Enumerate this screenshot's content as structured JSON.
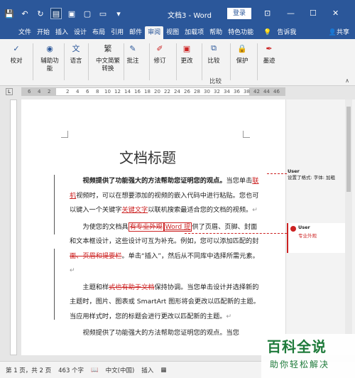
{
  "window": {
    "title": "文档3 - Word",
    "login_label": "登录",
    "controls": [
      "⊡",
      "—",
      "☐",
      "✕"
    ]
  },
  "quick_access": [
    "save",
    "undo",
    "redo",
    "read-mode",
    "page-setup",
    "new-doc",
    "open-doc",
    "more"
  ],
  "tabs": [
    {
      "label": "文件"
    },
    {
      "label": "开始"
    },
    {
      "label": "插入"
    },
    {
      "label": "设计"
    },
    {
      "label": "布局"
    },
    {
      "label": "引用"
    },
    {
      "label": "邮件"
    },
    {
      "label": "审阅",
      "active": true
    },
    {
      "label": "视图"
    },
    {
      "label": "加载项"
    },
    {
      "label": "帮助"
    },
    {
      "label": "特色功能"
    },
    {
      "label": "告诉我"
    },
    {
      "label": "共享"
    }
  ],
  "ribbon": {
    "groups": [
      {
        "label": "校对",
        "icon": "spellcheck-icon"
      },
      {
        "label": "辅助功能",
        "icon": "accessibility-icon"
      },
      {
        "label": "语言",
        "icon": "language-icon"
      },
      {
        "label": "中文简繁转换",
        "icon": "chinese-conversion-icon"
      },
      {
        "label": "批注",
        "icon": "comment-icon"
      },
      {
        "label": "修订",
        "icon": "track-changes-icon"
      },
      {
        "label": "更改",
        "icon": "changes-icon"
      },
      {
        "label": "比较",
        "icon": "compare-icon"
      },
      {
        "label": "保护",
        "icon": "protect-icon"
      },
      {
        "label": "墨迹",
        "icon": "ink-icon"
      }
    ],
    "compare_caption": "比较"
  },
  "ruler": {
    "numbers": [
      "6",
      "4",
      "2",
      "2",
      "4",
      "6",
      "8",
      "10",
      "12",
      "14",
      "16",
      "18",
      "20",
      "22",
      "24",
      "26",
      "28",
      "30",
      "32",
      "34",
      "36",
      "38",
      "42",
      "44",
      "46",
      "48"
    ]
  },
  "document": {
    "heading": "文档标题",
    "p1_bold": "视频提供了功能强大的方法帮助您证明您的观点。",
    "p1_rest_a": "当您单击",
    "p1_ins_1": "联机",
    "p1_rest_b": "视频时，可以在想要添加的视频的嵌入代码中进行粘贴。您也可以键入一个关键字",
    "p1_ins_2": "关键文字",
    "p1_rest_c": "以联机搜索最适合您的文档的视频。",
    "p2_a": "为使您的文档具",
    "p2_del_1": "有专业外观",
    "p2_ins_1": "Word 提",
    "p2_b": "供了页眉、页脚、封面和文本框设计，这些设计可互为补充。例如，您可以添加匹配的封",
    "p2_del_2": "面、页眉和提要栏",
    "p2_c": "。单击“插入”，然后从不同库中选择所需元素。",
    "p3_a": "主题和样",
    "p3_del_1": "式也有助于文档",
    "p3_b": "保持协调。当您单击设计并选择新的主题时，图片、图表或 SmartArt 图形将会更改以匹配新的主题。当应用样式时，您的标题会进行更改以匹配新的主题。",
    "p4": "视频提供了功能强大的方法帮助您证明您的观点。当您"
  },
  "balloons": [
    {
      "user": "User",
      "text": "设置了格式: 字体: 加粗"
    },
    {
      "user": "User",
      "text": "专业外观"
    }
  ],
  "status": {
    "page": "第 1 页，共 2 页",
    "words": "463 个字",
    "lang": "中文(中国)",
    "mode": "插入"
  },
  "watermark": {
    "big": "百科全说",
    "small": "助你轻松解决"
  },
  "colors": {
    "title_bar": "#2b579a",
    "revision": "#cc2222",
    "watermark": "#1e7a3a"
  }
}
